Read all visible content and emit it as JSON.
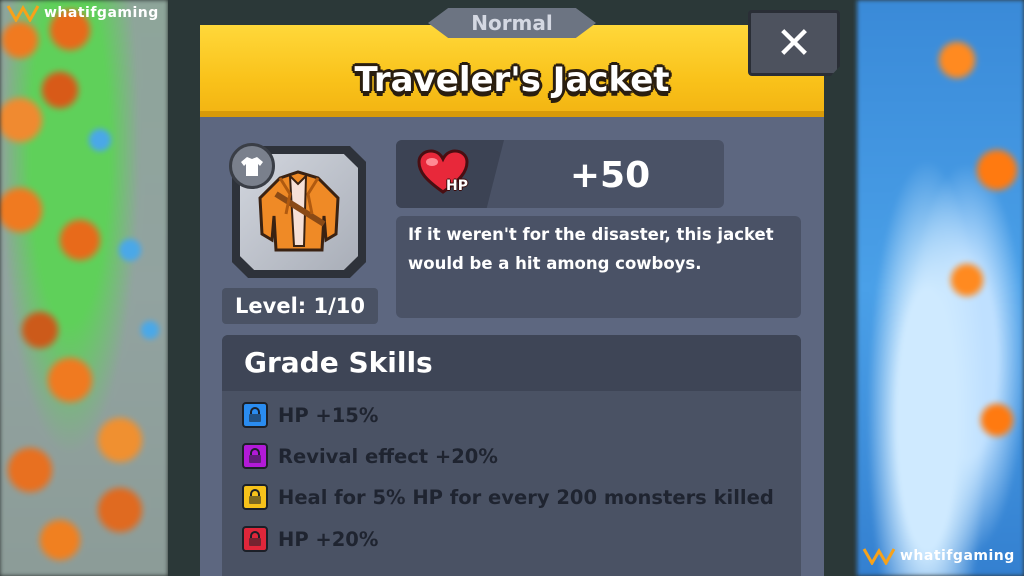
{
  "rarity": "Normal",
  "item": {
    "name": "Traveler's Jacket",
    "level": "Level: 1/10",
    "stat_label": "HP",
    "stat_value": "+50",
    "description": "If it weren't for the disaster, this jacket would be a hit among cowboys."
  },
  "close_label": "✕",
  "skills": {
    "title": "Grade Skills",
    "items": [
      {
        "text": "HP +15%",
        "lock_color": "#2a8cf0",
        "icon": "lock-icon"
      },
      {
        "text": "Revival effect +20%",
        "lock_color": "#b21ad8",
        "icon": "lock-icon"
      },
      {
        "text": "Heal for 5% HP for every 200 monsters killed",
        "lock_color": "#f7c21a",
        "icon": "lock-icon"
      },
      {
        "text": "HP +20%",
        "lock_color": "#e0263a",
        "icon": "lock-icon"
      }
    ]
  },
  "watermark": "whatifgaming",
  "colors": {
    "header_yellow": "#f9c21a",
    "panel": "#5d6780",
    "heart_red": "#e8283a"
  }
}
